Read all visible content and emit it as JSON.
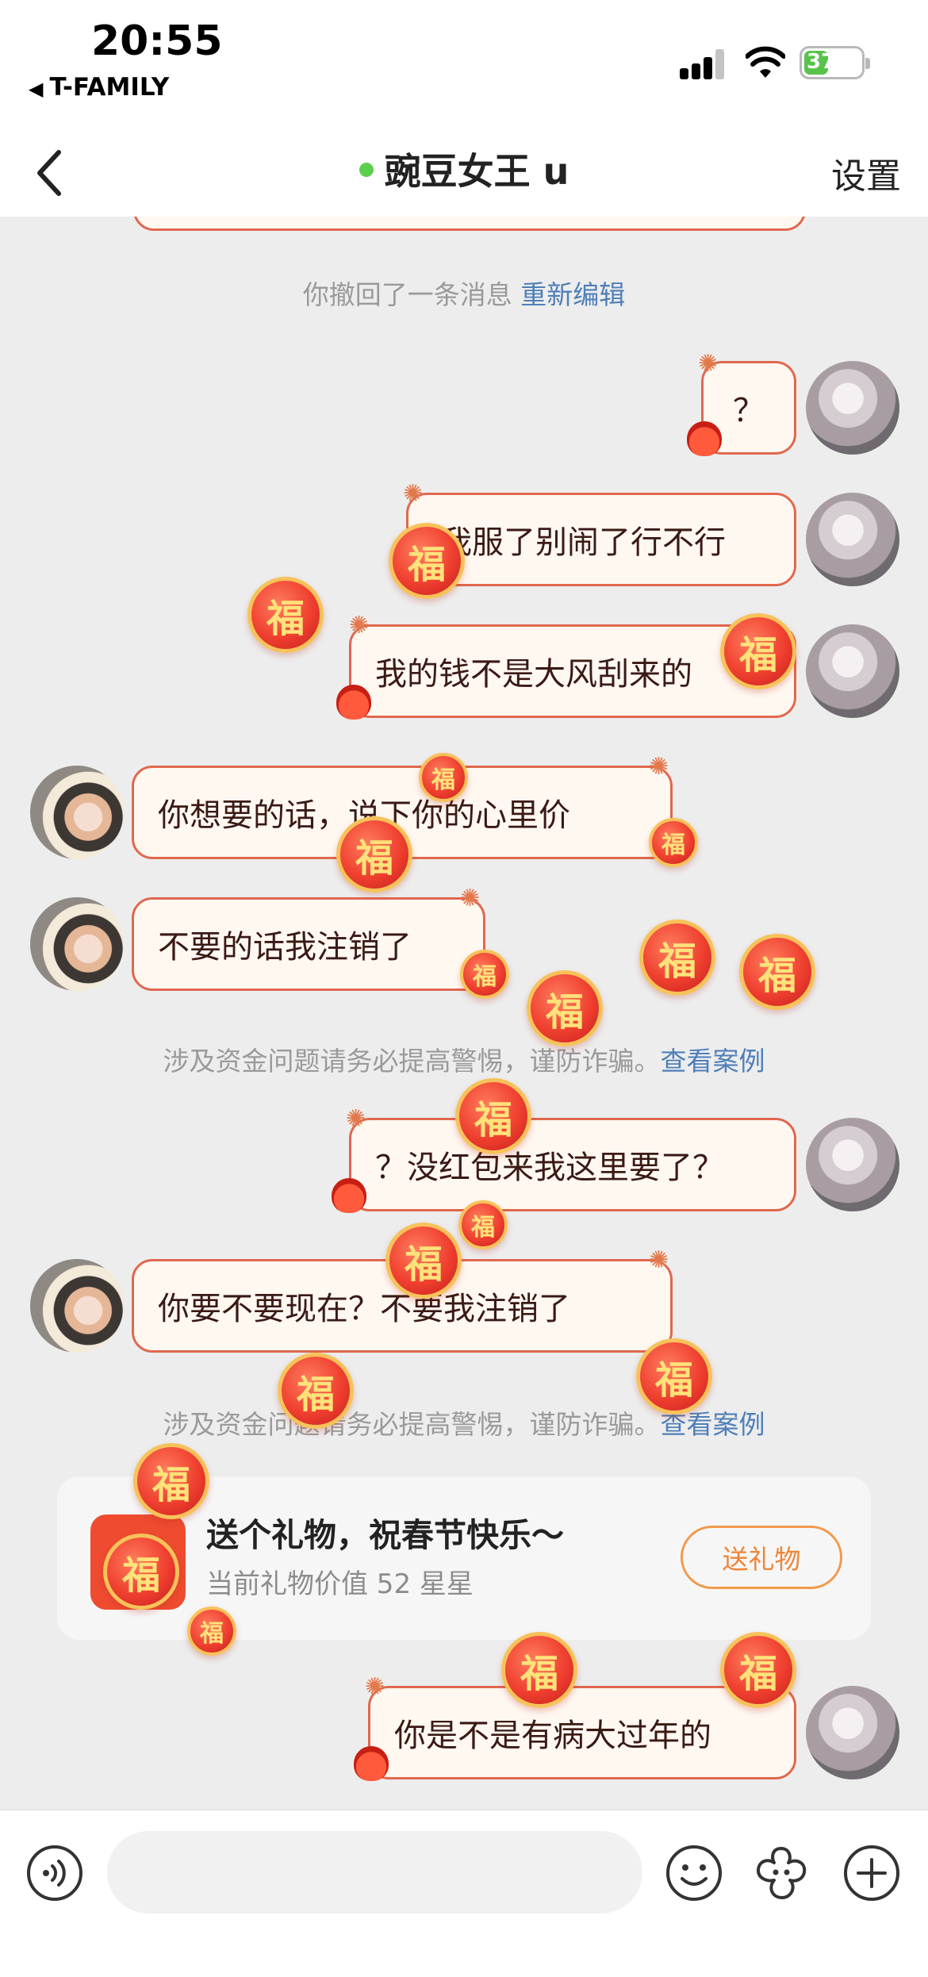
{
  "status_bar": {
    "time": "20:55",
    "carrier": "T-FAMILY",
    "carrier_prefix": "◀",
    "battery": "37"
  },
  "nav": {
    "title": "豌豆女王 u",
    "online_color": "#5bd04c",
    "settings_label": "设置"
  },
  "recall_notice": {
    "text": "你撤回了一条消息",
    "link": "重新编辑"
  },
  "messages": [
    {
      "side": "me",
      "text": "？"
    },
    {
      "side": "me",
      "text": "我服了别闹了行不行"
    },
    {
      "side": "me",
      "text": "我的钱不是大风刮来的"
    },
    {
      "side": "her",
      "text": "你想要的话，说下你的心里价"
    },
    {
      "side": "her",
      "text": "不要的话我注销了"
    },
    {
      "side": "me",
      "text": "？没红包来我这里要了？"
    },
    {
      "side": "her",
      "text": "你要不要现在？不要我注销了"
    },
    {
      "side": "me",
      "text": "你是不是有病大过年的"
    }
  ],
  "warnings": [
    {
      "text": "涉及资金问题请务必提高警惕，谨防诈骗。",
      "link": "查看案例"
    },
    {
      "text": "涉及资金问题请务必提高警惕，谨防诈骗。",
      "link": "查看案例"
    }
  ],
  "gift": {
    "title": "送个礼物，祝春节快乐～",
    "subtitle": "当前礼物价值 52 星星",
    "button": "送礼物"
  },
  "decor": {
    "fu_char": "福"
  },
  "input": {
    "placeholder": ""
  },
  "colors": {
    "bubble_border": "#e0684f",
    "bubble_bg": "#fff8f1",
    "link": "#4f7fb8",
    "gift_button": "#ee8537"
  }
}
